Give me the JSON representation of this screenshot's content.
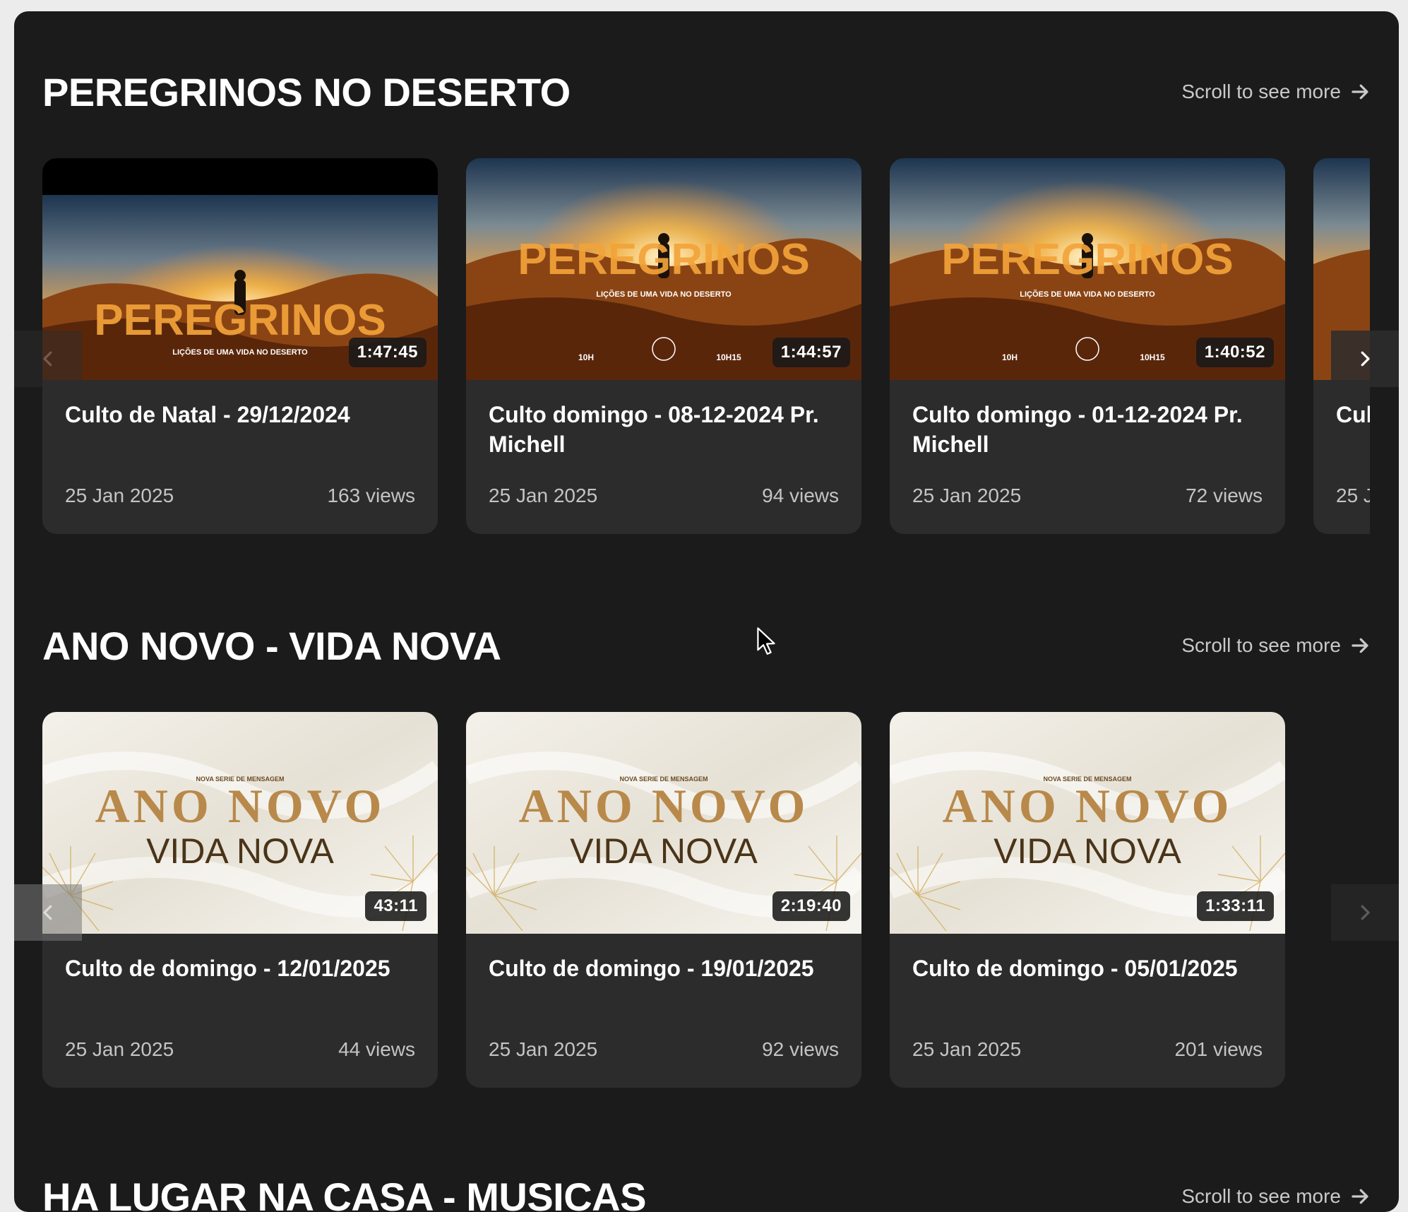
{
  "sections": [
    {
      "title": "PEREGRINOS NO DESERTO",
      "scroll_label": "Scroll to see more",
      "cards": [
        {
          "title": "Culto de Natal - 29/12/2024",
          "date": "25 Jan 2025",
          "views": "163 views",
          "duration": "1:47:45",
          "art_word": "PEREGRINOS",
          "art_sub": "LIÇÕES DE UMA VIDA NO DESERTO"
        },
        {
          "title": "Culto domingo - 08-12-2024 Pr. Michell",
          "date": "25 Jan 2025",
          "views": "94 views",
          "duration": "1:44:57",
          "art_word": "PEREGRINOS",
          "art_sub": "LIÇÕES DE UMA VIDA NO DESERTO",
          "art_times": [
            "10H",
            "10H15"
          ]
        },
        {
          "title": "Culto domingo - 01-12-2024 Pr. Michell",
          "date": "25 Jan 2025",
          "views": "72 views",
          "duration": "1:40:52",
          "art_word": "PEREGRINOS",
          "art_sub": "LIÇÕES DE UMA VIDA NO DESERTO",
          "art_times": [
            "10H",
            "10H15"
          ]
        },
        {
          "title": "Cul",
          "date": "25 J"
        }
      ]
    },
    {
      "title": "ANO NOVO - VIDA NOVA",
      "scroll_label": "Scroll to see more",
      "cards": [
        {
          "title": "Culto de domingo - 12/01/2025",
          "date": "25 Jan 2025",
          "views": "44 views",
          "duration": "43:11",
          "art_kicker": "NOVA SERIE DE MENSAGEM",
          "art_word": "ANO NOVO",
          "art_sub": "VIDA NOVA"
        },
        {
          "title": "Culto de domingo - 19/01/2025",
          "date": "25 Jan 2025",
          "views": "92 views",
          "duration": "2:19:40",
          "art_kicker": "NOVA SERIE DE MENSAGEM",
          "art_word": "ANO NOVO",
          "art_sub": "VIDA NOVA"
        },
        {
          "title": "Culto de domingo - 05/01/2025",
          "date": "25 Jan 2025",
          "views": "201 views",
          "duration": "1:33:11",
          "art_kicker": "NOVA SERIE DE MENSAGEM",
          "art_word": "ANO NOVO",
          "art_sub": "VIDA NOVA"
        }
      ]
    },
    {
      "title": "HA LUGAR NA CASA - MUSICAS",
      "scroll_label": "Scroll to see more"
    }
  ],
  "icons": {
    "scroll_arrow": "arrow-right-icon",
    "nav_prev": "chevron-left-icon",
    "nav_next": "chevron-right-icon",
    "pointer": "mouse-cursor-icon"
  },
  "colors": {
    "page_bg": "#1b1b1b",
    "card_bg": "#2c2c2c",
    "gold": "#b8894a",
    "brown": "#4a3418"
  }
}
